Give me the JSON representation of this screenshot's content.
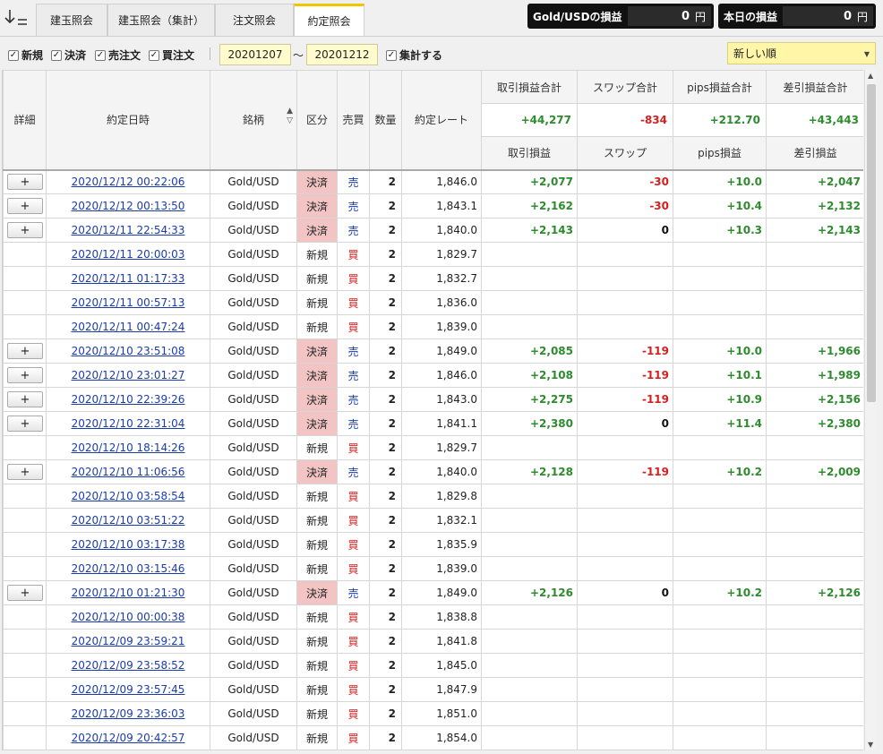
{
  "tabs": [
    {
      "label": "建玉照会",
      "active": false
    },
    {
      "label": "建玉照会（集計）",
      "active": false
    },
    {
      "label": "注文照会",
      "active": false
    },
    {
      "label": "約定照会",
      "active": true
    }
  ],
  "kpis": {
    "gold_pl": {
      "label": "Gold/USDの損益",
      "value": "0",
      "unit": "円"
    },
    "today_pl": {
      "label": "本日の損益",
      "value": "0",
      "unit": "円"
    }
  },
  "filters": {
    "new": {
      "label": "新規",
      "checked": true
    },
    "settle": {
      "label": "決済",
      "checked": true
    },
    "sell": {
      "label": "売注文",
      "checked": true
    },
    "buy": {
      "label": "買注文",
      "checked": true
    },
    "date_from": "20201207",
    "date_sep": "〜",
    "date_to": "20201212",
    "aggregate": {
      "label": "集計する",
      "checked": true
    },
    "order": "新しい順"
  },
  "headers": {
    "detail": "詳細",
    "datetime": "約定日時",
    "symbol": "銘柄",
    "kubun": "区分",
    "side": "売買",
    "qty": "数量",
    "rate": "約定レート",
    "trade_pl_total": "取引損益合計",
    "swap_total": "スワップ合計",
    "pips_total": "pips損益合計",
    "net_total": "差引損益合計",
    "trade_pl": "取引損益",
    "swap": "スワップ",
    "pips": "pips損益",
    "net": "差引損益"
  },
  "totals": {
    "trade_pl": "+44,277",
    "swap": "-834",
    "pips": "+212.70",
    "net": "+43,443"
  },
  "rows": [
    {
      "detail": "+",
      "datetime": "2020/12/12 00:22:06",
      "symbol": "Gold/USD",
      "kubun": "決済",
      "side": "売",
      "qty": "2",
      "rate": "1,846.0",
      "trade_pl": "+2,077",
      "swap": "-30",
      "pips": "+10.0",
      "net": "+2,047"
    },
    {
      "detail": "+",
      "datetime": "2020/12/12 00:13:50",
      "symbol": "Gold/USD",
      "kubun": "決済",
      "side": "売",
      "qty": "2",
      "rate": "1,843.1",
      "trade_pl": "+2,162",
      "swap": "-30",
      "pips": "+10.4",
      "net": "+2,132"
    },
    {
      "detail": "+",
      "datetime": "2020/12/11 22:54:33",
      "symbol": "Gold/USD",
      "kubun": "決済",
      "side": "売",
      "qty": "2",
      "rate": "1,840.0",
      "trade_pl": "+2,143",
      "swap": "0",
      "pips": "+10.3",
      "net": "+2,143"
    },
    {
      "detail": "",
      "datetime": "2020/12/11 20:00:03",
      "symbol": "Gold/USD",
      "kubun": "新規",
      "side": "買",
      "qty": "2",
      "rate": "1,829.7",
      "trade_pl": "",
      "swap": "",
      "pips": "",
      "net": ""
    },
    {
      "detail": "",
      "datetime": "2020/12/11 01:17:33",
      "symbol": "Gold/USD",
      "kubun": "新規",
      "side": "買",
      "qty": "2",
      "rate": "1,832.7",
      "trade_pl": "",
      "swap": "",
      "pips": "",
      "net": ""
    },
    {
      "detail": "",
      "datetime": "2020/12/11 00:57:13",
      "symbol": "Gold/USD",
      "kubun": "新規",
      "side": "買",
      "qty": "2",
      "rate": "1,836.0",
      "trade_pl": "",
      "swap": "",
      "pips": "",
      "net": ""
    },
    {
      "detail": "",
      "datetime": "2020/12/11 00:47:24",
      "symbol": "Gold/USD",
      "kubun": "新規",
      "side": "買",
      "qty": "2",
      "rate": "1,839.0",
      "trade_pl": "",
      "swap": "",
      "pips": "",
      "net": ""
    },
    {
      "detail": "+",
      "datetime": "2020/12/10 23:51:08",
      "symbol": "Gold/USD",
      "kubun": "決済",
      "side": "売",
      "qty": "2",
      "rate": "1,849.0",
      "trade_pl": "+2,085",
      "swap": "-119",
      "pips": "+10.0",
      "net": "+1,966"
    },
    {
      "detail": "+",
      "datetime": "2020/12/10 23:01:27",
      "symbol": "Gold/USD",
      "kubun": "決済",
      "side": "売",
      "qty": "2",
      "rate": "1,846.0",
      "trade_pl": "+2,108",
      "swap": "-119",
      "pips": "+10.1",
      "net": "+1,989"
    },
    {
      "detail": "+",
      "datetime": "2020/12/10 22:39:26",
      "symbol": "Gold/USD",
      "kubun": "決済",
      "side": "売",
      "qty": "2",
      "rate": "1,843.0",
      "trade_pl": "+2,275",
      "swap": "-119",
      "pips": "+10.9",
      "net": "+2,156"
    },
    {
      "detail": "+",
      "datetime": "2020/12/10 22:31:04",
      "symbol": "Gold/USD",
      "kubun": "決済",
      "side": "売",
      "qty": "2",
      "rate": "1,841.1",
      "trade_pl": "+2,380",
      "swap": "0",
      "pips": "+11.4",
      "net": "+2,380"
    },
    {
      "detail": "",
      "datetime": "2020/12/10 18:14:26",
      "symbol": "Gold/USD",
      "kubun": "新規",
      "side": "買",
      "qty": "2",
      "rate": "1,829.7",
      "trade_pl": "",
      "swap": "",
      "pips": "",
      "net": ""
    },
    {
      "detail": "+",
      "datetime": "2020/12/10 11:06:56",
      "symbol": "Gold/USD",
      "kubun": "決済",
      "side": "売",
      "qty": "2",
      "rate": "1,840.0",
      "trade_pl": "+2,128",
      "swap": "-119",
      "pips": "+10.2",
      "net": "+2,009"
    },
    {
      "detail": "",
      "datetime": "2020/12/10 03:58:54",
      "symbol": "Gold/USD",
      "kubun": "新規",
      "side": "買",
      "qty": "2",
      "rate": "1,829.8",
      "trade_pl": "",
      "swap": "",
      "pips": "",
      "net": ""
    },
    {
      "detail": "",
      "datetime": "2020/12/10 03:51:22",
      "symbol": "Gold/USD",
      "kubun": "新規",
      "side": "買",
      "qty": "2",
      "rate": "1,832.1",
      "trade_pl": "",
      "swap": "",
      "pips": "",
      "net": ""
    },
    {
      "detail": "",
      "datetime": "2020/12/10 03:17:38",
      "symbol": "Gold/USD",
      "kubun": "新規",
      "side": "買",
      "qty": "2",
      "rate": "1,835.9",
      "trade_pl": "",
      "swap": "",
      "pips": "",
      "net": ""
    },
    {
      "detail": "",
      "datetime": "2020/12/10 03:15:46",
      "symbol": "Gold/USD",
      "kubun": "新規",
      "side": "買",
      "qty": "2",
      "rate": "1,839.0",
      "trade_pl": "",
      "swap": "",
      "pips": "",
      "net": ""
    },
    {
      "detail": "+",
      "datetime": "2020/12/10 01:21:30",
      "symbol": "Gold/USD",
      "kubun": "決済",
      "side": "売",
      "qty": "2",
      "rate": "1,849.0",
      "trade_pl": "+2,126",
      "swap": "0",
      "pips": "+10.2",
      "net": "+2,126"
    },
    {
      "detail": "",
      "datetime": "2020/12/10 00:00:38",
      "symbol": "Gold/USD",
      "kubun": "新規",
      "side": "買",
      "qty": "2",
      "rate": "1,838.8",
      "trade_pl": "",
      "swap": "",
      "pips": "",
      "net": ""
    },
    {
      "detail": "",
      "datetime": "2020/12/09 23:59:21",
      "symbol": "Gold/USD",
      "kubun": "新規",
      "side": "買",
      "qty": "2",
      "rate": "1,841.8",
      "trade_pl": "",
      "swap": "",
      "pips": "",
      "net": ""
    },
    {
      "detail": "",
      "datetime": "2020/12/09 23:58:52",
      "symbol": "Gold/USD",
      "kubun": "新規",
      "side": "買",
      "qty": "2",
      "rate": "1,845.0",
      "trade_pl": "",
      "swap": "",
      "pips": "",
      "net": ""
    },
    {
      "detail": "",
      "datetime": "2020/12/09 23:57:45",
      "symbol": "Gold/USD",
      "kubun": "新規",
      "side": "買",
      "qty": "2",
      "rate": "1,847.9",
      "trade_pl": "",
      "swap": "",
      "pips": "",
      "net": ""
    },
    {
      "detail": "",
      "datetime": "2020/12/09 23:36:03",
      "symbol": "Gold/USD",
      "kubun": "新規",
      "side": "買",
      "qty": "2",
      "rate": "1,851.0",
      "trade_pl": "",
      "swap": "",
      "pips": "",
      "net": ""
    },
    {
      "detail": "",
      "datetime": "2020/12/09 20:42:57",
      "symbol": "Gold/USD",
      "kubun": "新規",
      "side": "買",
      "qty": "2",
      "rate": "1,854.0",
      "trade_pl": "",
      "swap": "",
      "pips": "",
      "net": ""
    }
  ],
  "colors": {
    "accent": "#f2c400",
    "positive": "#2e8b2e",
    "negative": "#d42020",
    "settle_bg": "#f2c4c4",
    "link": "#1a3caa"
  },
  "icons": {
    "sort_toggle": "sort-down-icon",
    "symbol_sort": "sort-arrows-icon",
    "order_dropdown": "chevron-down-icon"
  }
}
